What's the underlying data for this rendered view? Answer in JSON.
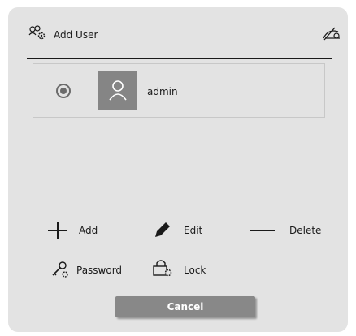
{
  "dialog": {
    "title": "Add User"
  },
  "users": [
    {
      "name": "admin",
      "selected": true
    }
  ],
  "actions": {
    "add": "Add",
    "edit": "Edit",
    "delete": "Delete",
    "password": "Password",
    "lock": "Lock"
  },
  "footer": {
    "cancel": "Cancel"
  },
  "icons": {
    "header_left": "users-gear-icon",
    "header_right": "visibility-off-icon"
  }
}
